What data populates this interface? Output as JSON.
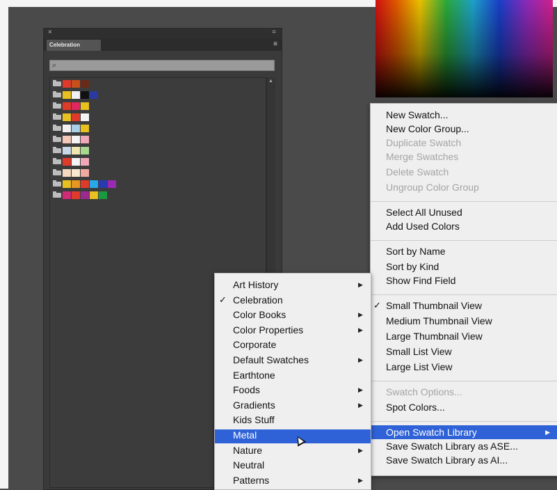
{
  "panel": {
    "title": "Celebration",
    "close_glyph": "×",
    "collapse_glyph": "=",
    "menu_glyph": "≡",
    "search_icon": "search-icon",
    "swatch_groups": [
      [
        "#e03a2a",
        "#c8501a",
        "#6a2a18"
      ],
      [
        "#e8c020",
        "#f2f2f2",
        "#101010",
        "#2a3aa0"
      ],
      [
        "#e03a2a",
        "#e02860",
        "#e8c020"
      ],
      [
        "#e8c020",
        "#e03a2a",
        "#f4f4f4"
      ],
      [
        "#f2f2f2",
        "#a8d0e8",
        "#e8c020"
      ],
      [
        "#f4c8b8",
        "#f4f4f4",
        "#f0a8b8"
      ],
      [
        "#c8d8e8",
        "#f0e8b0",
        "#a8d890"
      ],
      [
        "#e03a2a",
        "#f4f4f4",
        "#f0a8b8"
      ],
      [
        "#f4d8c0",
        "#f8e8d0",
        "#f0a8a0"
      ],
      [
        "#e8c020",
        "#e89820",
        "#e03a2a",
        "#28a8e8",
        "#2a3ab0",
        "#9a2ab0"
      ],
      [
        "#d02a78",
        "#e03a2a",
        "#9a2a90",
        "#e8c020",
        "#1a9a40"
      ]
    ]
  },
  "menu": {
    "items": [
      {
        "label": "New Swatch...",
        "disabled": false
      },
      {
        "label": "New Color Group...",
        "disabled": false
      },
      {
        "label": "Duplicate Swatch",
        "disabled": true
      },
      {
        "label": "Merge Swatches",
        "disabled": true
      },
      {
        "label": "Delete Swatch",
        "disabled": true
      },
      {
        "label": "Ungroup Color Group",
        "disabled": true
      },
      {
        "label": "Select All Unused",
        "disabled": false
      },
      {
        "label": "Add Used Colors",
        "disabled": false
      },
      {
        "label": "Sort by Name",
        "disabled": false
      },
      {
        "label": "Sort by Kind",
        "disabled": false
      },
      {
        "label": "Show Find Field",
        "disabled": false
      },
      {
        "label": "Small Thumbnail View",
        "disabled": false,
        "checked": true
      },
      {
        "label": "Medium Thumbnail View",
        "disabled": false
      },
      {
        "label": "Large Thumbnail View",
        "disabled": false
      },
      {
        "label": "Small List View",
        "disabled": false
      },
      {
        "label": "Large List View",
        "disabled": false
      },
      {
        "label": "Swatch Options...",
        "disabled": true
      },
      {
        "label": "Spot Colors...",
        "disabled": false
      },
      {
        "label": "Open Swatch Library",
        "disabled": false,
        "highlighted": true,
        "submenu": true
      },
      {
        "label": "Save Swatch Library as ASE...",
        "disabled": false
      },
      {
        "label": "Save Swatch Library as AI...",
        "disabled": false
      }
    ],
    "check_glyph": "✓",
    "arrow_glyph": "▶"
  },
  "library_submenu": {
    "items": [
      {
        "label": "Art History",
        "submenu": true
      },
      {
        "label": "Celebration",
        "checked": true
      },
      {
        "label": "Color Books",
        "submenu": true
      },
      {
        "label": "Color Properties",
        "submenu": true
      },
      {
        "label": "Corporate"
      },
      {
        "label": "Default Swatches",
        "submenu": true
      },
      {
        "label": "Earthtone"
      },
      {
        "label": "Foods",
        "submenu": true
      },
      {
        "label": "Gradients",
        "submenu": true
      },
      {
        "label": "Kids Stuff"
      },
      {
        "label": "Metal",
        "highlighted": true
      },
      {
        "label": "Nature",
        "submenu": true
      },
      {
        "label": "Neutral"
      },
      {
        "label": "Patterns",
        "submenu": true
      }
    ]
  }
}
